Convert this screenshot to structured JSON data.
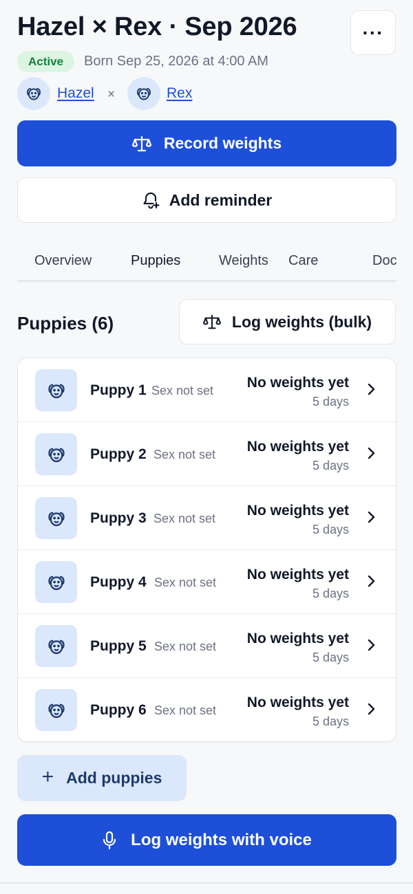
{
  "header": {
    "title": "Hazel × Rex · Sep 2026",
    "more_label": "···",
    "status": "Active",
    "born": "Born Sep 25, 2026 at 4:00 AM"
  },
  "parents": {
    "dam": "Hazel",
    "separator": "×",
    "sire": "Rex"
  },
  "actions": {
    "record_weights": "Record weights",
    "add_reminder": "Add reminder"
  },
  "tabs": [
    {
      "label": "Overview"
    },
    {
      "label": "Puppies",
      "active": true
    },
    {
      "label": "Weights"
    },
    {
      "label": "Care"
    },
    {
      "label": "Documents"
    }
  ],
  "puppies_section": {
    "title": "Puppies (6)",
    "bulk_button": "Log weights (bulk)",
    "items": [
      {
        "name": "Puppy 1",
        "sex": "Sex not set",
        "status": "No weights yet",
        "age": "5 days"
      },
      {
        "name": "Puppy 2",
        "sex": "Sex not set",
        "status": "No weights yet",
        "age": "5 days"
      },
      {
        "name": "Puppy 3",
        "sex": "Sex not set",
        "status": "No weights yet",
        "age": "5 days"
      },
      {
        "name": "Puppy 4",
        "sex": "Sex not set",
        "status": "No weights yet",
        "age": "5 days"
      },
      {
        "name": "Puppy 5",
        "sex": "Sex not set",
        "status": "No weights yet",
        "age": "5 days"
      },
      {
        "name": "Puppy 6",
        "sex": "Sex not set",
        "status": "No weights yet",
        "age": "5 days"
      }
    ],
    "add_button": "Add puppies"
  },
  "voice_button": "Log weights with voice",
  "colors": {
    "primary": "#1d4fd8",
    "active_badge_bg": "#dcf5e3",
    "active_badge_text": "#15803d",
    "avatar_bg": "#dbe8fb",
    "link": "#1d4ed8"
  }
}
